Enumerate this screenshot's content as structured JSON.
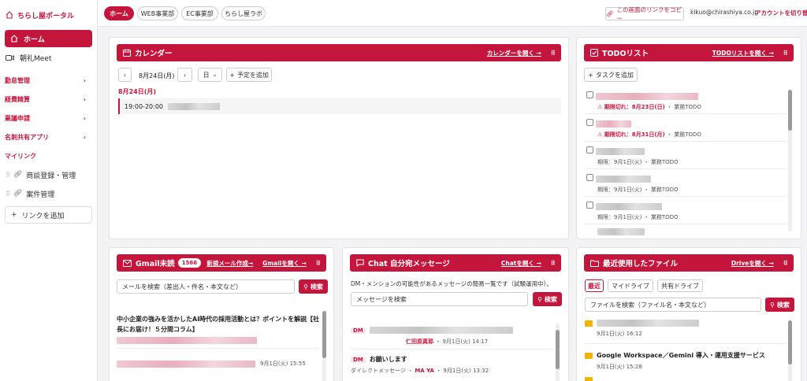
{
  "sidebar": {
    "brand": "ちらし屋ポータル",
    "home": "ホーム",
    "meet": "朝礼Meet",
    "categories": [
      "勤怠管理",
      "経費精算",
      "稟議申請",
      "名刺共有アプリ"
    ],
    "mylink_header": "マイリンク",
    "mylinks": [
      "商談登録・管理",
      "案件管理"
    ],
    "add_link": "リンクを追加"
  },
  "topbar": {
    "tabs": [
      "ホーム",
      "WEB事業部",
      "EC事業部",
      "ちらし屋ラボ"
    ],
    "copy_link": "この画面のリンクをコピー",
    "email": "kikuo@chirashiya.co.jp",
    "switch_account": "アカウントを切り替え"
  },
  "calendar": {
    "title": "カレンダー",
    "open_link": "カレンダーを開く →",
    "date": "8月24日(月)",
    "view": "日",
    "add_event": "予定を追加",
    "day_label": "8月24日(月)",
    "event_time": "19:00-20:00"
  },
  "todo": {
    "title": "TODOリスト",
    "open_link": "TODOリストを開く →",
    "add_task": "タスクを追加",
    "items": [
      {
        "deadline": "⚠ 期限切れ：8月23日(日)",
        "tag": "業務TODO"
      },
      {
        "deadline": "⚠ 期限切れ：8月31日(月)",
        "tag": "業務TODO"
      },
      {
        "deadline": "期限：9月1日(火)",
        "tag": "業務TODO"
      },
      {
        "deadline": "期限：9月1日(火)",
        "tag": "業務TODO"
      },
      {
        "deadline": "期限：9月1日(火)",
        "tag": "業務TODO"
      }
    ],
    "separator": "・"
  },
  "gmail": {
    "title": "Gmail未読",
    "count": "1566",
    "compose_link": "新規メール作成→",
    "open_link": "Gmailを開く →",
    "search_placeholder": "メールを検索（差出人・件名・本文など）",
    "search_button": "検索",
    "mail1_subject": "中小企業の強みを活かしたAI時代の採用活動とは？ポイントを解説【社長にお届け！５分間コラム】",
    "mail2_time": "9月1日(火) 15:55"
  },
  "chat": {
    "title": "Chat 自分宛メッセージ",
    "open_link": "Chatを開く →",
    "description": "DM・メンションの可能性があるメッセージの簡易一覧です（試験運用中）。",
    "search_placeholder": "メッセージを検索",
    "search_button": "検索",
    "msg1_tag": "DM",
    "msg1_sender": "仁田原真耶",
    "msg1_time": "9月1日(火) 14:17",
    "msg2_tag": "DM",
    "msg2_text": "お願いします",
    "msg2_source": "ダイレクトメッセージ",
    "msg2_sender": "MA YA",
    "msg2_time": "9月1日(火) 13:32"
  },
  "files": {
    "title": "最近使用したファイル",
    "open_link": "Driveを開く →",
    "tabs": [
      "最近",
      "マイドライブ",
      "共有ドライブ"
    ],
    "search_placeholder": "ファイルを検索（ファイル名・本文など）",
    "search_button": "検索",
    "file1_time": "9月1日(火) 16:12",
    "file2_name": "Google Workspace／Gemini 導入・運用支援サービス",
    "file2_time": "9月1日(火) 15:28"
  },
  "colors": {
    "accent": "#c4163d"
  }
}
